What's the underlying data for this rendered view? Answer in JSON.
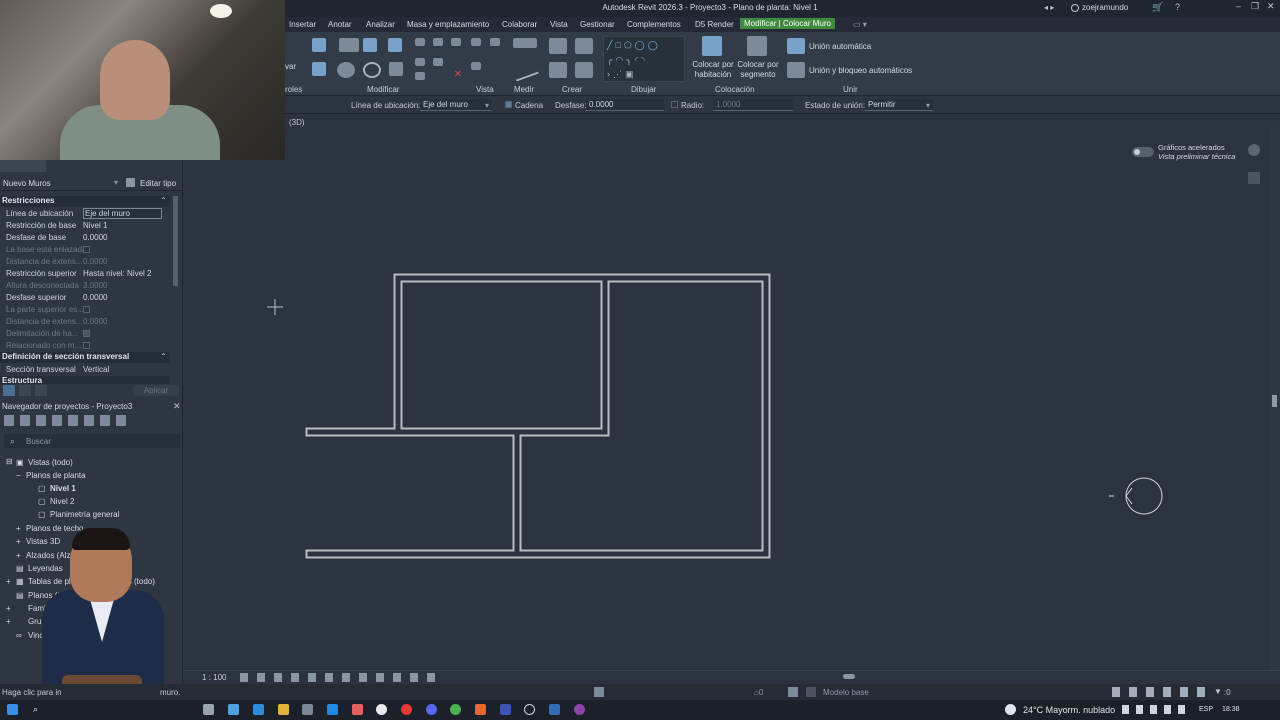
{
  "window": {
    "title": "Autodesk Revit 2026.3 - Proyecto3 - Plano de planta: Nivel 1",
    "user": "zoejramundo"
  },
  "menu": {
    "items": [
      "Insertar",
      "Anotar",
      "Analizar",
      "Masa y emplazamiento",
      "Colaborar",
      "Vista",
      "Gestionar",
      "Complementos",
      "D5 Render"
    ],
    "active_tab": "Modificar | Colocar Muro"
  },
  "ribbon": {
    "groups": [
      "Modificar",
      "Vista",
      "Medir",
      "Crear",
      "Dibujar",
      "Colocación",
      "Unir"
    ],
    "left_labels": [
      "var",
      "roles"
    ],
    "placement": {
      "by_room": "Colocar por habitación",
      "by_segment": "Colocar por segmento"
    },
    "join": {
      "auto": "Unión automática",
      "auto_lock": "Unión y bloqueo automáticos"
    }
  },
  "options_bar": {
    "location_line_label": "Línea de ubicación:",
    "location_line_value": "Eje del muro",
    "chain_label": "Cadena",
    "chain_checked": true,
    "offset_label": "Desfase:",
    "offset_value": "0.0000",
    "radius_label": "Radio:",
    "radius_value": "1.0000",
    "join_status_label": "Estado de unión:",
    "join_status_value": "Permitir"
  },
  "view": {
    "tab": "(3D)",
    "scale": "1 : 100",
    "graphics_title": "Gráficos acelerados",
    "graphics_subtitle": "Vista preliminar técnica"
  },
  "properties": {
    "type_name": "Nuevo Muros",
    "edit_type": "Editar tipo",
    "section_constraints": "Restricciones",
    "rows": [
      {
        "name": "Línea de ubicación",
        "value": "Eje del muro",
        "dim": false,
        "boxed": true
      },
      {
        "name": "Restricción de base",
        "value": "Nivel 1",
        "dim": false
      },
      {
        "name": "Desfase de base",
        "value": "0.0000",
        "dim": false
      },
      {
        "name": "La base está enlazada",
        "value": "",
        "dim": true,
        "check": true
      },
      {
        "name": "Distancia de extens...",
        "value": "0.0000",
        "dim": true
      },
      {
        "name": "Restricción superior",
        "value": "Hasta nivel: Nivel 2",
        "dim": false
      },
      {
        "name": "Altura desconectada",
        "value": "3.0000",
        "dim": true
      },
      {
        "name": "Desfase superior",
        "value": "0.0000",
        "dim": false
      },
      {
        "name": "La parte superior es...",
        "value": "",
        "dim": true,
        "check": true
      },
      {
        "name": "Distancia de extens...",
        "value": "0.0000",
        "dim": true
      },
      {
        "name": "Delimitación de ha...",
        "value": "",
        "dim": true,
        "check": true
      },
      {
        "name": "Relacionado con m...",
        "value": "",
        "dim": true,
        "check": true
      }
    ],
    "section_cross": "Definición de sección transversal",
    "cross_row": {
      "name": "Sección transversal",
      "value": "Vertical"
    },
    "section_structure": "Estructura",
    "apply": "Aplicar"
  },
  "browser": {
    "title": "Navegador de proyectos - Proyecto3",
    "search_placeholder": "Buscar",
    "tree": [
      {
        "label": "Vistas (todo)",
        "indent": 0,
        "bold": false
      },
      {
        "label": "Planos de planta",
        "indent": 1,
        "bold": false
      },
      {
        "label": "Nivel 1",
        "indent": 2,
        "bold": true
      },
      {
        "label": "Nivel 2",
        "indent": 2,
        "bold": false
      },
      {
        "label": "Planimetría general",
        "indent": 2,
        "bold": false
      },
      {
        "label": "Planos de techo",
        "indent": 1,
        "bold": false
      },
      {
        "label": "Vistas 3D",
        "indent": 1,
        "bold": false
      },
      {
        "label": "Alzados (Alzado",
        "indent": 1,
        "bold": false
      },
      {
        "label": "Leyendas",
        "indent": 0,
        "bold": false
      },
      {
        "label": "Tablas de planifi",
        "indent": 0,
        "bold": false,
        "suffix": "dades (todo)"
      },
      {
        "label": "Planos (todo)",
        "indent": 0,
        "bold": false
      },
      {
        "label": "Famil",
        "indent": 0,
        "bold": false
      },
      {
        "label": "Grupo",
        "indent": 0,
        "bold": false
      },
      {
        "label": "Vincu",
        "indent": 0,
        "bold": false
      }
    ]
  },
  "status": {
    "hint": "Haga clic para in",
    "hint_tail": "muro.",
    "model_base": "Modelo base",
    "filter_count": ":0"
  },
  "taskbar": {
    "weather": "24°C  Mayorm. nublado",
    "lang": "ESP",
    "time": "18:38"
  }
}
